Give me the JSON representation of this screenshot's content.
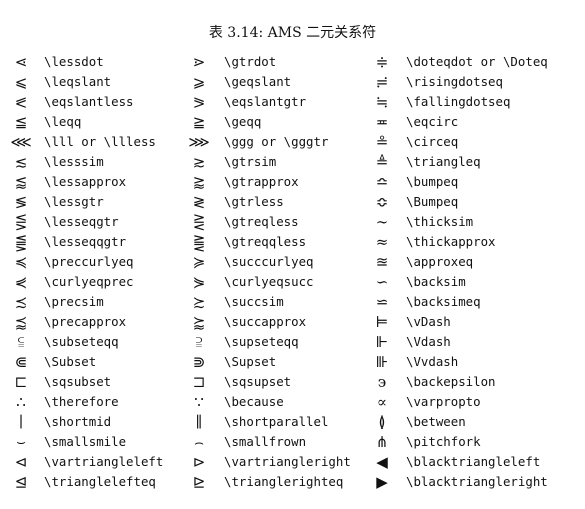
{
  "table": {
    "caption": "表 3.14: AMS 二元关系符",
    "rows": [
      [
        {
          "symbol": "⋖",
          "command": "\\lessdot"
        },
        {
          "symbol": "⋗",
          "command": "\\gtrdot"
        },
        {
          "symbol": "≑",
          "command": "\\doteqdot or \\Doteq"
        }
      ],
      [
        {
          "symbol": "⩽",
          "command": "\\leqslant"
        },
        {
          "symbol": "⩾",
          "command": "\\geqslant"
        },
        {
          "symbol": "≓",
          "command": "\\risingdotseq"
        }
      ],
      [
        {
          "symbol": "⪕",
          "command": "\\eqslantless"
        },
        {
          "symbol": "⪖",
          "command": "\\eqslantgtr"
        },
        {
          "symbol": "≒",
          "command": "\\fallingdotseq"
        }
      ],
      [
        {
          "symbol": "≦",
          "command": "\\leqq"
        },
        {
          "symbol": "≧",
          "command": "\\geqq"
        },
        {
          "symbol": "≖",
          "command": "\\eqcirc"
        }
      ],
      [
        {
          "symbol": "⋘",
          "command": "\\lll or \\llless"
        },
        {
          "symbol": "⋙",
          "command": "\\ggg or \\gggtr"
        },
        {
          "symbol": "≗",
          "command": "\\circeq"
        }
      ],
      [
        {
          "symbol": "≲",
          "command": "\\lesssim"
        },
        {
          "symbol": "≳",
          "command": "\\gtrsim"
        },
        {
          "symbol": "≜",
          "command": "\\triangleq"
        }
      ],
      [
        {
          "symbol": "⪅",
          "command": "\\lessapprox"
        },
        {
          "symbol": "⪆",
          "command": "\\gtrapprox"
        },
        {
          "symbol": "≏",
          "command": "\\bumpeq"
        }
      ],
      [
        {
          "symbol": "≶",
          "command": "\\lessgtr"
        },
        {
          "symbol": "≷",
          "command": "\\gtrless"
        },
        {
          "symbol": "≎",
          "command": "\\Bumpeq"
        }
      ],
      [
        {
          "symbol": "⋚",
          "command": "\\lesseqgtr"
        },
        {
          "symbol": "⋛",
          "command": "\\gtreqless"
        },
        {
          "symbol": "∼",
          "command": "\\thicksim"
        }
      ],
      [
        {
          "symbol": "⪋",
          "command": "\\lesseqqgtr"
        },
        {
          "symbol": "⪌",
          "command": "\\gtreqqless"
        },
        {
          "symbol": "≈",
          "command": "\\thickapprox"
        }
      ],
      [
        {
          "symbol": "≼",
          "command": "\\preccurlyeq"
        },
        {
          "symbol": "≽",
          "command": "\\succcurlyeq"
        },
        {
          "symbol": "≊",
          "command": "\\approxeq"
        }
      ],
      [
        {
          "symbol": "⋞",
          "command": "\\curlyeqprec"
        },
        {
          "symbol": "⋟",
          "command": "\\curlyeqsucc"
        },
        {
          "symbol": "∽",
          "command": "\\backsim"
        }
      ],
      [
        {
          "symbol": "≾",
          "command": "\\precsim"
        },
        {
          "symbol": "≿",
          "command": "\\succsim"
        },
        {
          "symbol": "⋍",
          "command": "\\backsimeq"
        }
      ],
      [
        {
          "symbol": "⪷",
          "command": "\\precapprox"
        },
        {
          "symbol": "⪸",
          "command": "\\succapprox"
        },
        {
          "symbol": "⊨",
          "command": "\\vDash"
        }
      ],
      [
        {
          "symbol": "⫅",
          "command": "\\subseteqq"
        },
        {
          "symbol": "⫆",
          "command": "\\supseteqq"
        },
        {
          "symbol": "⊩",
          "command": "\\Vdash"
        }
      ],
      [
        {
          "symbol": "⋐",
          "command": "\\Subset"
        },
        {
          "symbol": "⋑",
          "command": "\\Supset"
        },
        {
          "symbol": "⊪",
          "command": "\\Vvdash"
        }
      ],
      [
        {
          "symbol": "⊏",
          "command": "\\sqsubset"
        },
        {
          "symbol": "⊐",
          "command": "\\sqsupset"
        },
        {
          "symbol": "϶",
          "command": "\\backepsilon"
        }
      ],
      [
        {
          "symbol": "∴",
          "command": "\\therefore"
        },
        {
          "symbol": "∵",
          "command": "\\because"
        },
        {
          "symbol": "∝",
          "command": "\\varpropto"
        }
      ],
      [
        {
          "symbol": "∣",
          "command": "\\shortmid"
        },
        {
          "symbol": "∥",
          "command": "\\shortparallel"
        },
        {
          "symbol": "≬",
          "command": "\\between"
        }
      ],
      [
        {
          "symbol": "⌣",
          "command": "\\smallsmile"
        },
        {
          "symbol": "⌢",
          "command": "\\smallfrown"
        },
        {
          "symbol": "⋔",
          "command": "\\pitchfork"
        }
      ],
      [
        {
          "symbol": "⊲",
          "command": "\\vartriangleleft"
        },
        {
          "symbol": "⊳",
          "command": "\\vartriangleright"
        },
        {
          "symbol": "◀",
          "command": "\\blacktriangleleft"
        }
      ],
      [
        {
          "symbol": "⊴",
          "command": "\\trianglelefteq"
        },
        {
          "symbol": "⊵",
          "command": "\\trianglerighteq"
        },
        {
          "symbol": "▶",
          "command": "\\blacktriangleright"
        }
      ]
    ]
  }
}
